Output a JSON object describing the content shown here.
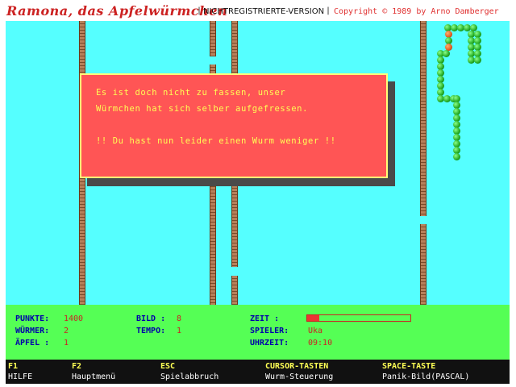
{
  "title_bar": {
    "game_title": "Ramona, das Apfelwürmchen",
    "separator": "|",
    "version": "NICHTREGISTRIERTE-VERSION",
    "copyright": "Copyright ©  1989 by Arno Damberger"
  },
  "dialog": {
    "line1": "Es ist doch nicht zu fassen, unser",
    "line2": "Würmchen hat sich selber aufgefressen.",
    "line3": "!! Du hast nun leider einen Wurm weniger !!"
  },
  "status": {
    "punkte_label": "PUNKTE:",
    "punkte_value": "1400",
    "wuermer_label": "WÜRMER:",
    "wuermer_value": "2",
    "aepfel_label": "ÄPFEL :",
    "aepfel_value": "1",
    "bild_label": "BILD  :",
    "bild_value": "8",
    "tempo_label": "TEMPO:",
    "tempo_value": "1",
    "zeit_label": "ZEIT   :",
    "zeit_progress": 0.12,
    "spieler_label": "SPIELER:",
    "spieler_value": "Uka",
    "uhrzeit_label": "UHRZEIT:",
    "uhrzeit_value": "09:10"
  },
  "function_keys": [
    {
      "key": "F1",
      "desc": "HILFE"
    },
    {
      "key": "F2",
      "desc": "Hauptmenü"
    },
    {
      "key": "ESC",
      "desc": "Spielabbruch"
    },
    {
      "key": "CURSOR-TASTEN",
      "desc": "Wurm-Steuerung"
    },
    {
      "key": "SPACE-TASTE",
      "desc": "Panik-Bild(PASCAL)"
    }
  ],
  "colors": {
    "playfield": "#55ffff",
    "dialog": "#ff5555",
    "status_panel": "#55ff55",
    "key_bar": "#111111",
    "worm": "#22aa22",
    "apple": "#e05a20"
  }
}
